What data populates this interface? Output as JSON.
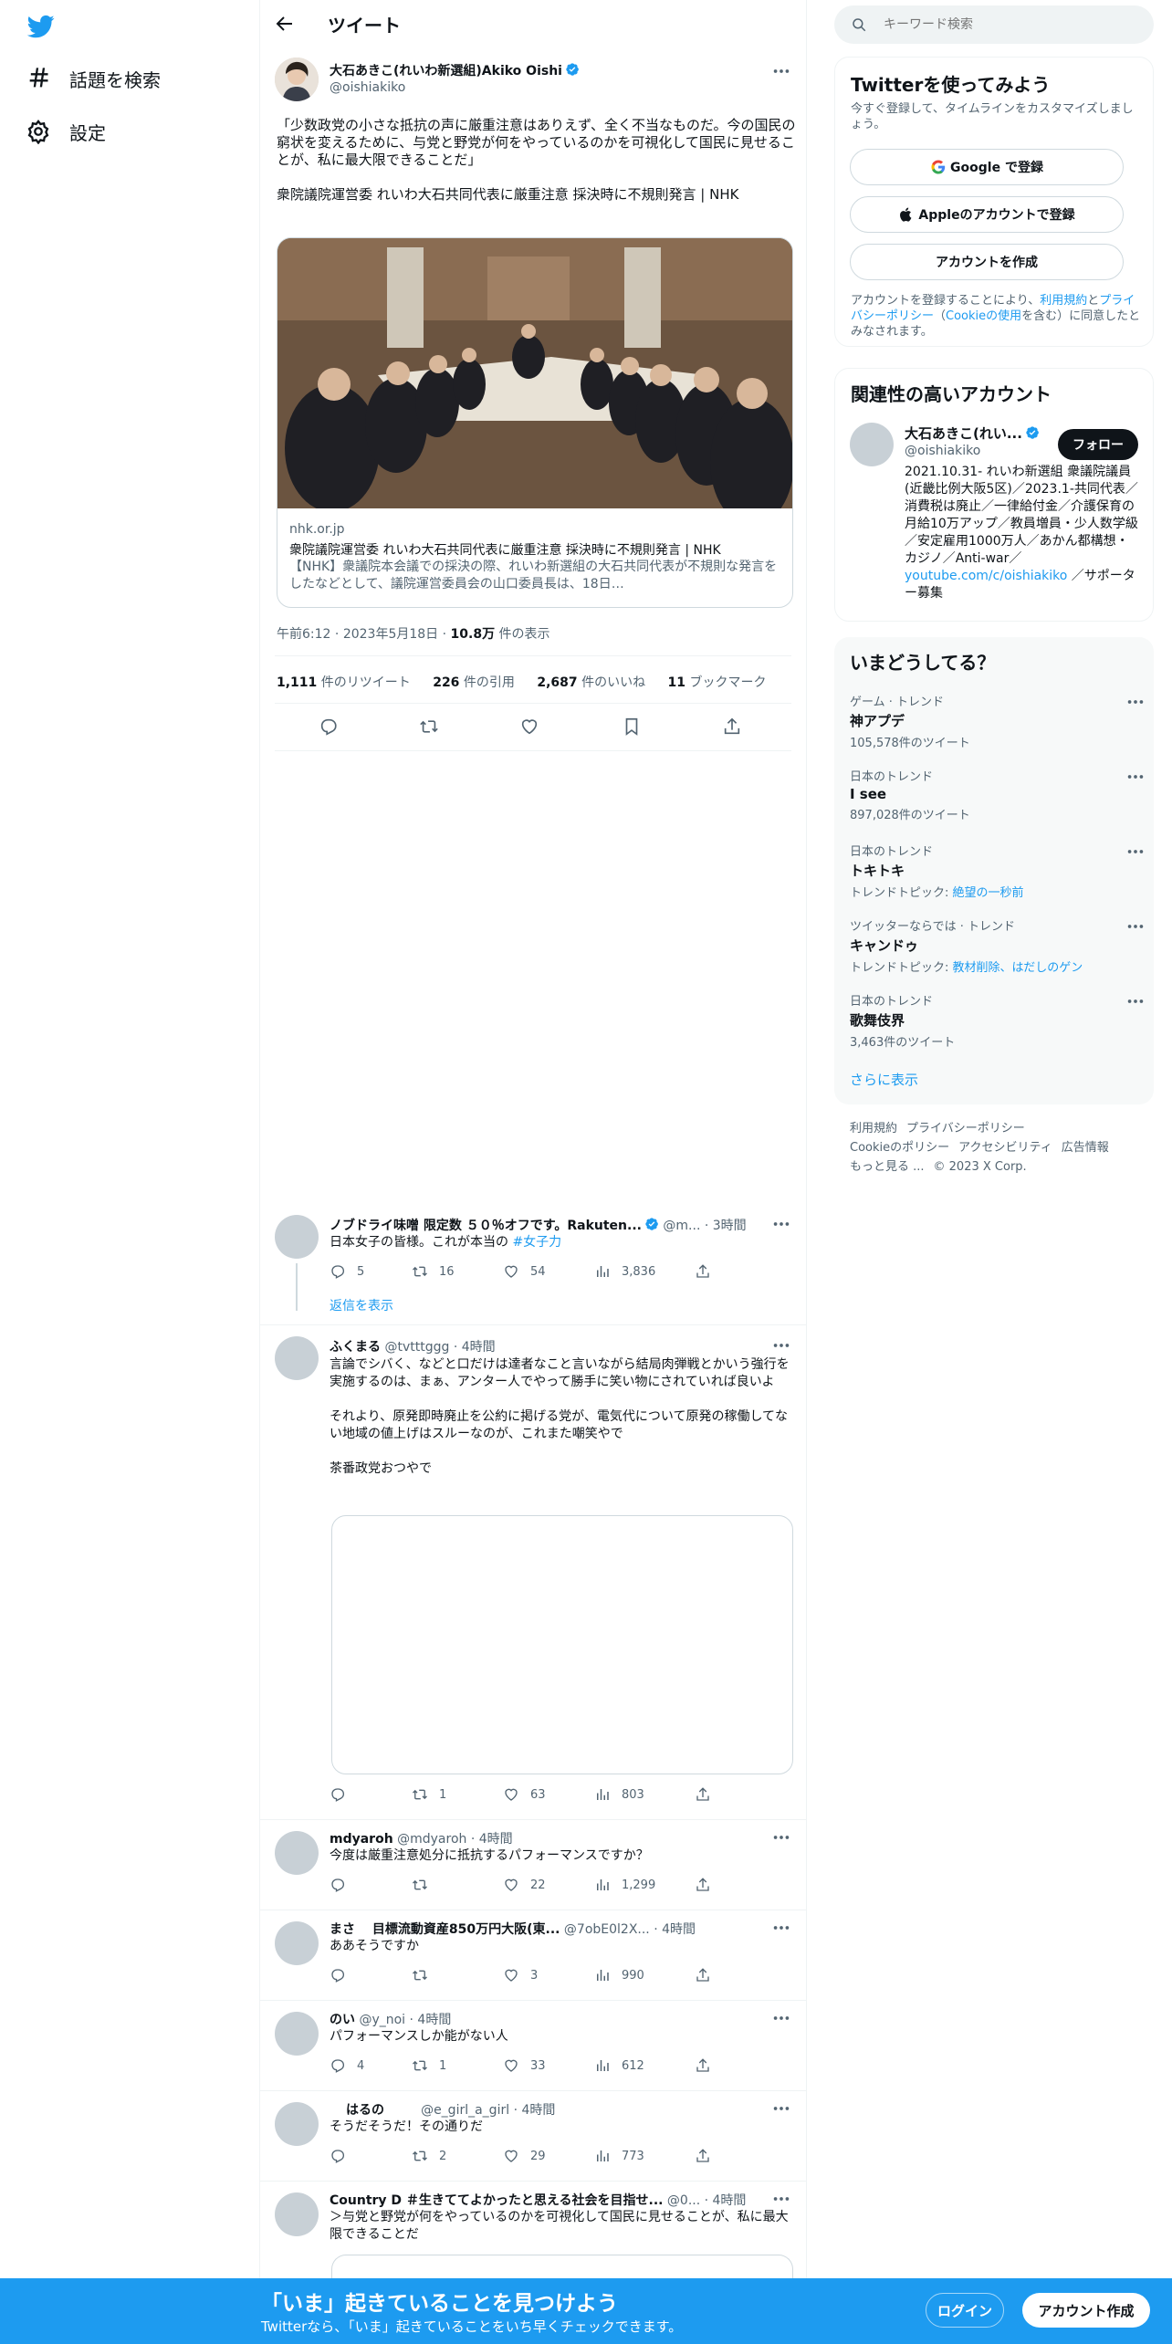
{
  "nav": {
    "explore_label": "話題を検索",
    "settings_label": "設定"
  },
  "header": {
    "title": "ツイート"
  },
  "tweet": {
    "author_name": "大石あきこ(れいわ新選組)Akiko Oishi",
    "author_handle": "@oishiakiko",
    "text": "「少数政党の小さな抵抗の声に厳重注意はありえず、全く不当なものだ。今の国民の窮状を変えるために、与党と野党が何をやっているのかを可視化して国民に見せることが、私に最大限できることだ」\n\n衆院議院運営委 れいわ大石共同代表に厳重注意 採決時に不規則発言 | NHK",
    "card": {
      "domain": "nhk.or.jp",
      "title": "衆院議院運営委 れいわ大石共同代表に厳重注意 採決時に不規則発言 | NHK",
      "description": "【NHK】衆議院本会議での採決の際、れいわ新選組の大石共同代表が不規則な発言をしたなどとして、議院運営委員会の山口委員長は、18日…"
    },
    "time": "午前6:12",
    "date": "2023年5月18日",
    "views": "10.8万",
    "views_label": "件の表示",
    "stats": {
      "retweets": "1,111",
      "retweets_label": "件のリツイート",
      "quotes": "226",
      "quotes_label": "件の引用",
      "likes": "2,687",
      "likes_label": "件のいいね",
      "bookmarks": "11",
      "bookmarks_label": "ブックマーク"
    }
  },
  "replies": [
    {
      "name": "ノブドライ味噌 限定数 ５０％オフです。Rakuten...",
      "handle": "@m...",
      "time": "· 3時間",
      "text": "日本女子の皆様。これが本当の ",
      "hashtag": "#女子力",
      "reply_count": "5",
      "retweet_count": "16",
      "like_count": "54",
      "view_count": "3,836",
      "show_replies": "返信を表示"
    },
    {
      "name": "ふくまる",
      "handle": "@tvtttggg",
      "time": "· 4時間",
      "text": "言論でシバく、などと口だけは達者なこと言いながら結局肉弾戦とかいう強行を実施するのは、まぁ、アンター人でやって勝手に笑い物にされていれば良いよ\n\nそれより、原発即時廃止を公約に掲げる党が、電気代について原発の稼働してない地域の値上げはスルーなのが、これまた嘲笑やで\n\n茶番政党おつやで",
      "reply_count": "",
      "retweet_count": "1",
      "like_count": "63",
      "view_count": "803"
    },
    {
      "name": "mdyaroh",
      "handle": "@mdyaroh",
      "time": "· 4時間",
      "text": "今度は厳重注意処分に抵抗するパフォーマンスですか？",
      "reply_count": "",
      "retweet_count": "",
      "like_count": "22",
      "view_count": "1,299"
    },
    {
      "name": "まさ　 目標流動資産850万円大阪(東...",
      "handle": "@7obE0l2X...",
      "time": "· 4時間",
      "text": "ああそうですか",
      "reply_count": "",
      "retweet_count": "",
      "like_count": "3",
      "view_count": "990"
    },
    {
      "name": "のい",
      "handle": "@y_noi",
      "time": "· 4時間",
      "text": "パフォーマンスしか能がない人",
      "reply_count": "4",
      "retweet_count": "1",
      "like_count": "33",
      "view_count": "612"
    },
    {
      "name": "はるの",
      "handle": "@e_girl_a_girl",
      "time": "· 4時間",
      "text": "そうだそうだ！その通りだ",
      "reply_count": "",
      "retweet_count": "2",
      "like_count": "29",
      "view_count": "773"
    },
    {
      "name": "Country D ＃生きててよかったと思える社会を目指せ...",
      "handle": "@0...",
      "time": "· 4時間",
      "text": "＞与党と野党が何をやっているのかを可視化して国民に見せることが、私に最大限できることだ"
    }
  ],
  "search": {
    "placeholder": "キーワード検索"
  },
  "signup": {
    "title": "Twitterを使ってみよう",
    "subtitle": "今すぐ登録して、タイムラインをカスタマイズしましょう。",
    "google_label": "Google で登録",
    "apple_label": "Appleのアカウントで登録",
    "create_label": "アカウントを作成",
    "terms_prefix": "アカウントを登録することにより、",
    "terms_link": "利用規約",
    "terms_and": "と",
    "privacy_link": "プライバシーポリシー",
    "terms_paren_open": "（",
    "cookie_link": "Cookieの使用",
    "terms_suffix": "を含む）に同意したとみなされます。"
  },
  "related": {
    "title": "関連性の高いアカウント",
    "name": "大石あきこ(れい...",
    "handle": "@oishiakiko",
    "follow_label": "フォロー",
    "bio": "2021.10.31- れいわ新選組 衆議院議員(近畿比例大阪5区)／2023.1-共同代表／消費税は廃止／一律給付金／介護保育の月給10万アップ／教員増員・少人数学級／安定雇用1000万人／あかん都構想・カジノ／Anti-war／",
    "bio_link": "youtube.com/c/oishiakiko",
    "bio_suffix": " ／サポーター募集"
  },
  "trends": {
    "title": "いまどうしてる？",
    "items": [
      {
        "context": "ゲーム · トレンド",
        "name": "神アプデ",
        "count": "105,578件のツイート"
      },
      {
        "context": "日本のトレンド",
        "name": "I see",
        "count": "897,028件のツイート"
      },
      {
        "context": "日本のトレンド",
        "name": "トキトキ",
        "count_prefix": "トレンドトピック: ",
        "count_link": "絶望の一秒前"
      },
      {
        "context": "ツイッターならでは · トレンド",
        "name": "キャンドゥ",
        "count_prefix": "トレンドトピック: ",
        "count_link": "教材削除、はだしのゲン"
      },
      {
        "context": "日本のトレンド",
        "name": "歌舞伎界",
        "count": "3,463件のツイート"
      }
    ],
    "show_more": "さらに表示"
  },
  "footer": {
    "terms": "利用規約",
    "privacy": "プライバシーポリシー",
    "cookie": "Cookieのポリシー",
    "accessibility": "アクセシビリティ",
    "ads": "広告情報",
    "more": "もっと見る ...",
    "copyright": "© 2023 X Corp."
  },
  "bottom_bar": {
    "title": "「いま」起きていることを見つけよう",
    "subtitle": "Twitterなら、「いま」起きていることをいち早くチェックできます。",
    "login_label": "ログイン",
    "register_label": "アカウント作成"
  },
  "colors": {
    "accent": "#1d9bf0",
    "text": "#0f1419",
    "muted": "#536471",
    "border": "#eff3f4"
  }
}
